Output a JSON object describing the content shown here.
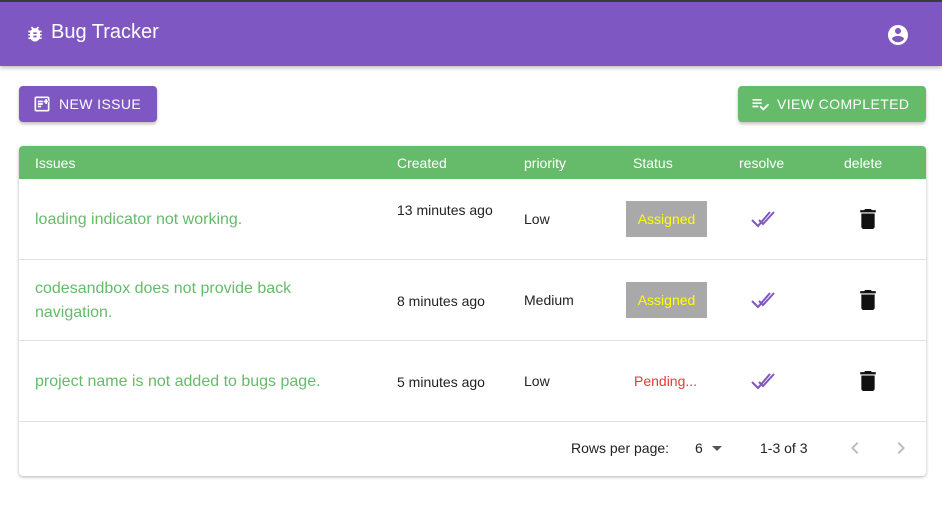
{
  "appbar": {
    "title": "Bug Tracker",
    "color": "#7e57c2"
  },
  "toolbar": {
    "new_issue_label": "NEW ISSUE",
    "view_completed_label": "VIEW COMPLETED"
  },
  "table": {
    "headers": [
      "Issues",
      "Created",
      "priority",
      "Status",
      "resolve",
      "delete"
    ],
    "header_color": "#66bb6a",
    "rows": [
      {
        "issue": "loading indicator not working.",
        "created": "13 minutes ago",
        "priority": "Low",
        "status": "Assigned"
      },
      {
        "issue": "codesandbox does not provide back navigation.",
        "created": "8 minutes ago",
        "priority": "Medium",
        "status": "Assigned"
      },
      {
        "issue": "project name is not added to bugs page.",
        "created": "5 minutes ago",
        "priority": "Low",
        "status": "Pending..."
      }
    ]
  },
  "pagination": {
    "rows_per_page_label": "Rows per page:",
    "rows_per_page_value": "6",
    "range": "1-3 of 3"
  },
  "icons": {
    "appbar": [
      "bug-icon",
      "account-circle-icon"
    ],
    "new_issue": "note-add-icon",
    "view_completed": "playlist-check-icon",
    "resolve": "double-check-icon",
    "delete": "trash-icon",
    "pagination": [
      "chevron-left-icon",
      "chevron-right-icon"
    ]
  }
}
